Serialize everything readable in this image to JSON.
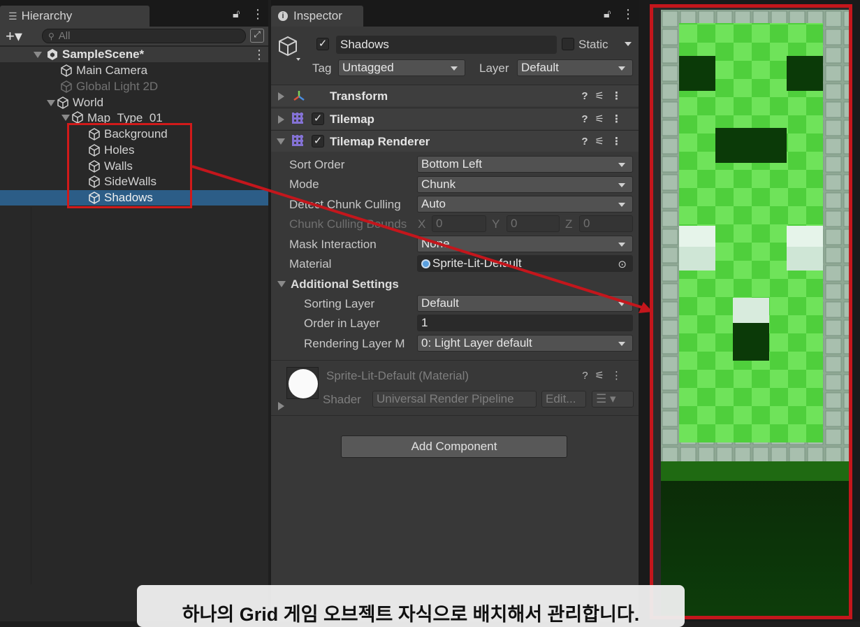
{
  "hierarchy": {
    "tab_title": "Hierarchy",
    "search_placeholder": "All",
    "items": [
      {
        "label": "SampleScene*"
      },
      {
        "label": "Main Camera"
      },
      {
        "label": "Global Light 2D"
      },
      {
        "label": "World"
      },
      {
        "label": "Map_Type_01"
      },
      {
        "label": "Background"
      },
      {
        "label": "Holes"
      },
      {
        "label": "Walls"
      },
      {
        "label": "SideWalls"
      },
      {
        "label": "Shadows"
      }
    ]
  },
  "inspector": {
    "tab_title": "Inspector",
    "object_name": "Shadows",
    "static_label": "Static",
    "tag_label": "Tag",
    "tag_value": "Untagged",
    "layer_label": "Layer",
    "layer_value": "Default",
    "components": {
      "transform": "Transform",
      "tilemap": "Tilemap",
      "tilemap_renderer": "Tilemap Renderer"
    },
    "props": {
      "sort_order_label": "Sort Order",
      "sort_order_value": "Bottom Left",
      "mode_label": "Mode",
      "mode_value": "Chunk",
      "detect_label": "Detect Chunk Culling",
      "detect_value": "Auto",
      "chunk_bounds_label": "Chunk Culling Bounds",
      "x_label": "X",
      "x_value": "0",
      "y_label": "Y",
      "y_value": "0",
      "z_label": "Z",
      "z_value": "0",
      "mask_label": "Mask Interaction",
      "mask_value": "None",
      "material_label": "Material",
      "material_value": "Sprite-Lit-Default",
      "additional_settings": "Additional Settings",
      "sorting_layer_label": "Sorting Layer",
      "sorting_layer_value": "Default",
      "order_label": "Order in Layer",
      "order_value": "1",
      "rendering_layer_label": "Rendering Layer M",
      "rendering_layer_value": "0: Light Layer default"
    },
    "material_block": {
      "title": "Sprite-Lit-Default (Material)",
      "shader_label": "Shader",
      "shader_value": "Universal Render Pipeline",
      "edit_label": "Edit..."
    },
    "add_component": "Add Component"
  },
  "caption": "하나의 Grid 게임 오브젝트 자식으로 배치해서 관리합니다.",
  "colors": {
    "selection": "#2c5d87",
    "highlight_red": "#d11a1a",
    "grass_light": "#6fe35a",
    "grass_dark": "#4fcf3c"
  }
}
